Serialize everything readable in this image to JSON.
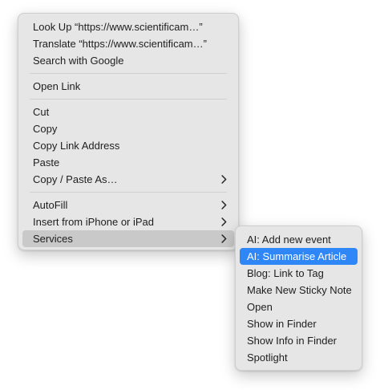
{
  "context_menu": {
    "group1": [
      {
        "label": "Look Up “https://www.scientificam…”"
      },
      {
        "label": "Translate “https://www.scientificam…”"
      },
      {
        "label": "Search with Google"
      }
    ],
    "group2": [
      {
        "label": "Open Link"
      }
    ],
    "group3": [
      {
        "label": "Cut"
      },
      {
        "label": "Copy"
      },
      {
        "label": "Copy Link Address"
      },
      {
        "label": "Paste"
      },
      {
        "label": "Copy / Paste As…",
        "has_submenu": true
      }
    ],
    "group4": [
      {
        "label": "AutoFill",
        "has_submenu": true
      },
      {
        "label": "Insert from iPhone or iPad",
        "has_submenu": true
      },
      {
        "label": "Services",
        "has_submenu": true,
        "highlighted": true
      }
    ]
  },
  "services_submenu": {
    "items": [
      {
        "label": "AI: Add new event"
      },
      {
        "label": "AI: Summarise Article",
        "highlighted": true
      },
      {
        "label": "Blog: Link to Tag"
      },
      {
        "label": "Make New Sticky Note"
      },
      {
        "label": "Open"
      },
      {
        "label": "Show in Finder"
      },
      {
        "label": "Show Info in Finder"
      },
      {
        "label": "Spotlight"
      }
    ]
  },
  "colors": {
    "menu_background": "#e6e6e6",
    "hover_grey": "#c9c9c9",
    "selection_blue": "#2f86f6",
    "text": "#1e1e1e"
  }
}
